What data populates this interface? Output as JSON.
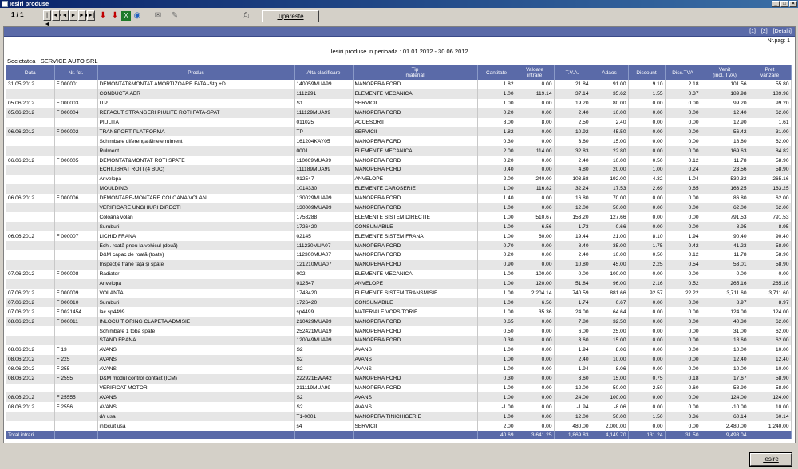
{
  "window": {
    "title": "Iesiri produse"
  },
  "toolbar": {
    "page_indicator": "1 / 1",
    "print_label": "Tipareste",
    "nav": [
      "|◄",
      "◄◄",
      "◄",
      "►",
      "►►",
      "►|"
    ]
  },
  "report": {
    "links": [
      "[1]",
      "[2]",
      "[Detalii]"
    ],
    "page_number": "Nr.pag: 1",
    "title": "Iesiri produse in perioada : 01.01.2012 - 30.06.2012",
    "company": "Societatea : SERVICE AUTO SRL",
    "columns": [
      "Data",
      "Nr. fct.",
      "Produs",
      "Alta clasificare",
      "Tip\nmaterial",
      "Cantitate",
      "Valoare\nintrare",
      "T.V.A.",
      "Adaos",
      "Discount",
      "Disc.TVA",
      "Venit\n(incl. TVA)",
      "Pret\nvanzare"
    ],
    "rows": [
      [
        "31.05.2012",
        "F 000001",
        "DEMONTAT&MONTAT AMORTIZOARE FATA -Stg.+D",
        "140059MUA99",
        "MANOPERA FORD",
        "1.82",
        "0.00",
        "21.84",
        "91.00",
        "9.10",
        "2.18",
        "101.56",
        "55.80"
      ],
      [
        "",
        "",
        "CONDUCTA AER",
        "1112291",
        "ELEMENTE MECANICA",
        "1.00",
        "119.14",
        "37.14",
        "35.62",
        "1.55",
        "0.37",
        "189.98",
        "189.98"
      ],
      [
        "05.06.2012",
        "F 000003",
        "ITP",
        "S1",
        "SERVICII",
        "1.00",
        "0.00",
        "19.20",
        "80.00",
        "0.00",
        "0.00",
        "99.20",
        "99.20"
      ],
      [
        "05.06.2012",
        "F 000004",
        "REFACUT STRANGERI PIULITE ROTI FATA-SPAT",
        "111129MUA99",
        "MANOPERA FORD",
        "0.20",
        "0.00",
        "2.40",
        "10.00",
        "0.00",
        "0.00",
        "12.40",
        "62.00"
      ],
      [
        "",
        "",
        "PIULITA",
        "011025",
        "ACCESORII",
        "8.00",
        "8.00",
        "2.50",
        "2.40",
        "0.00",
        "0.00",
        "12.90",
        "1.61"
      ],
      [
        "06.06.2012",
        "F 000002",
        "TRANSPORT PLATFORMA",
        "TP",
        "SERVICII",
        "1.82",
        "0.00",
        "10.92",
        "45.50",
        "0.00",
        "0.00",
        "56.42",
        "31.00"
      ],
      [
        "",
        "",
        "Schimbare diferențial&inele rulment",
        "161204KAY05",
        "MANOPERA FORD",
        "0.30",
        "0.00",
        "3.60",
        "15.00",
        "0.00",
        "0.00",
        "18.60",
        "62.00"
      ],
      [
        "",
        "",
        "Rulment",
        "0001",
        "ELEMENTE MECANICA",
        "2.00",
        "114.00",
        "32.83",
        "22.80",
        "0.00",
        "0.00",
        "169.63",
        "84.82"
      ],
      [
        "06.06.2012",
        "F 000005",
        "DEMONTAT&MONTAT ROTI SPATE",
        "110009MUA99",
        "MANOPERA FORD",
        "0.20",
        "0.00",
        "2.40",
        "10.00",
        "0.50",
        "0.12",
        "11.78",
        "58.90"
      ],
      [
        "",
        "",
        "ECHILIBRAT ROTI (4 BUC)",
        "111189MUA99",
        "MANOPERA FORD",
        "0.40",
        "0.00",
        "4.80",
        "20.00",
        "1.00",
        "0.24",
        "23.56",
        "58.90"
      ],
      [
        "",
        "",
        "Anvelopa",
        "012547",
        "ANVELOPE",
        "2.00",
        "240.00",
        "103.68",
        "192.00",
        "4.32",
        "1.04",
        "530.32",
        "265.16"
      ],
      [
        "",
        "",
        "MOULDING",
        "1014330",
        "ELEMENTE CAROSERIE",
        "1.00",
        "116.82",
        "32.24",
        "17.53",
        "2.69",
        "0.65",
        "163.25",
        "163.25"
      ],
      [
        "06.06.2012",
        "F 000006",
        "DEMONTARE-MONTARE COLOANA VOLAN",
        "130029MUA99",
        "MANOPERA FORD",
        "1.40",
        "0.00",
        "16.80",
        "70.00",
        "0.00",
        "0.00",
        "86.80",
        "62.00"
      ],
      [
        "",
        "",
        "VERIFICARE UNGHIURI DIRECTI",
        "130009MUA99",
        "MANOPERA FORD",
        "1.00",
        "0.00",
        "12.00",
        "50.00",
        "0.00",
        "0.00",
        "62.00",
        "62.00"
      ],
      [
        "",
        "",
        "Coloana volan",
        "1758288",
        "ELEMENTE SISTEM DIRECTIE",
        "1.00",
        "510.67",
        "153.20",
        "127.66",
        "0.00",
        "0.00",
        "791.53",
        "791.53"
      ],
      [
        "",
        "",
        "Suruburi",
        "1726420",
        "CONSUMABILE",
        "1.00",
        "6.56",
        "1.73",
        "0.66",
        "0.00",
        "0.00",
        "8.95",
        "8.95"
      ],
      [
        "06.06.2012",
        "F 000007",
        "LICHID FRANA",
        "02145",
        "ELEMENTE SISTEM FRANA",
        "1.00",
        "60.00",
        "19.44",
        "21.00",
        "8.10",
        "1.94",
        "90.40",
        "90.40"
      ],
      [
        "",
        "",
        "Echl. roată pneu la vehicul (două)",
        "111230MUA07",
        "MANOPERA FORD",
        "0.70",
        "0.00",
        "8.40",
        "35.00",
        "1.75",
        "0.42",
        "41.23",
        "58.90"
      ],
      [
        "",
        "",
        "D&M capac de roată (toate)",
        "112300MUA07",
        "MANOPERA FORD",
        "0.20",
        "0.00",
        "2.40",
        "10.00",
        "0.50",
        "0.12",
        "11.78",
        "58.90"
      ],
      [
        "",
        "",
        "Inspecție frane față și spate",
        "121210MUA07",
        "MANOPERA FORD",
        "0.90",
        "0.00",
        "10.80",
        "45.00",
        "2.25",
        "0.54",
        "53.01",
        "58.90"
      ],
      [
        "07.06.2012",
        "F 000008",
        "Radiator",
        "002",
        "ELEMENTE MECANICA",
        "1.00",
        "100.00",
        "0.00",
        "-100.00",
        "0.00",
        "0.00",
        "0.00",
        "0.00"
      ],
      [
        "",
        "",
        "Anvelopa",
        "012547",
        "ANVELOPE",
        "1.00",
        "120.00",
        "51.84",
        "96.00",
        "2.16",
        "0.52",
        "265.16",
        "265.16"
      ],
      [
        "07.06.2012",
        "F 000009",
        "VOLANTA",
        "1748420",
        "ELEMENTE SISTEM TRANSMISIE",
        "1.00",
        "2,204.14",
        "740.59",
        "881.66",
        "92.57",
        "22.22",
        "3,711.60",
        "3,711.60"
      ],
      [
        "07.06.2012",
        "F 000010",
        "Suruburi",
        "1726420",
        "CONSUMABILE",
        "1.00",
        "6.56",
        "1.74",
        "0.67",
        "0.00",
        "0.00",
        "8.97",
        "8.97"
      ],
      [
        "07.06.2012",
        "F 0021454",
        "lac sp4499",
        "sp4499",
        "MATERIALE VOPSITORIE",
        "1.00",
        "35.36",
        "24.00",
        "64.64",
        "0.00",
        "0.00",
        "124.00",
        "124.00"
      ],
      [
        "08.06.2012",
        "F 000011",
        "INLOCUIT ORING CLAPETA ADMISIE",
        "210429MUA99",
        "MANOPERA FORD",
        "0.65",
        "0.00",
        "7.80",
        "32.50",
        "0.00",
        "0.00",
        "40.30",
        "62.00"
      ],
      [
        "",
        "",
        "Schimbare 1 tobă spate",
        "252421MUA19",
        "MANOPERA FORD",
        "0.50",
        "0.00",
        "6.00",
        "25.00",
        "0.00",
        "0.00",
        "31.00",
        "62.00"
      ],
      [
        "",
        "",
        "STAND FRANA",
        "120049MUA99",
        "MANOPERA FORD",
        "0.30",
        "0.00",
        "3.60",
        "15.00",
        "0.00",
        "0.00",
        "18.60",
        "62.00"
      ],
      [
        "08.06.2012",
        "F 13",
        "AVANS",
        "S2",
        "AVANS",
        "1.00",
        "0.00",
        "1.94",
        "8.06",
        "0.00",
        "0.00",
        "10.00",
        "10.00"
      ],
      [
        "08.06.2012",
        "F 225",
        "AVANS",
        "S2",
        "AVANS",
        "1.00",
        "0.00",
        "2.40",
        "10.00",
        "0.00",
        "0.00",
        "12.40",
        "12.40"
      ],
      [
        "08.06.2012",
        "F 255",
        "AVANS",
        "S2",
        "AVANS",
        "1.00",
        "0.00",
        "1.94",
        "8.06",
        "0.00",
        "0.00",
        "10.00",
        "10.00"
      ],
      [
        "08.06.2012",
        "F 2555",
        "D&M modul control contact (ICM)",
        "222921EWA42",
        "MANOPERA FORD",
        "0.30",
        "0.00",
        "3.60",
        "15.00",
        "0.75",
        "0.18",
        "17.67",
        "58.90"
      ],
      [
        "",
        "",
        "VERIFICAT MOTOR",
        "211119MUA99",
        "MANOPERA FORD",
        "1.00",
        "0.00",
        "12.00",
        "50.00",
        "2.50",
        "0.60",
        "58.90",
        "58.90"
      ],
      [
        "08.06.2012",
        "F 25555",
        "AVANS",
        "S2",
        "AVANS",
        "1.00",
        "0.00",
        "24.00",
        "100.00",
        "0.00",
        "0.00",
        "124.00",
        "124.00"
      ],
      [
        "08.06.2012",
        "F 2556",
        "AVANS",
        "S2",
        "AVANS",
        "-1.00",
        "0.00",
        "-1.94",
        "-8.06",
        "0.00",
        "0.00",
        "-10.00",
        "10.00"
      ],
      [
        "",
        "",
        "d/r usa",
        "T1-0001",
        "MANOPERA TINICHIGERIE",
        "1.00",
        "0.00",
        "12.00",
        "50.00",
        "1.50",
        "0.36",
        "60.14",
        "60.14"
      ],
      [
        "",
        "",
        "inlocuit usa",
        "s4",
        "SERVICII",
        "2.00",
        "0.00",
        "480.00",
        "2,000.00",
        "0.00",
        "0.00",
        "2,480.00",
        "1,240.00"
      ]
    ],
    "totals": [
      "Total intrari",
      "",
      "",
      "",
      "",
      "40.69",
      "3,641.25",
      "1,869.83",
      "4,149.70",
      "131.24",
      "31.50",
      "9,498.04",
      ""
    ]
  },
  "footer": {
    "exit_label": "Iesire"
  }
}
